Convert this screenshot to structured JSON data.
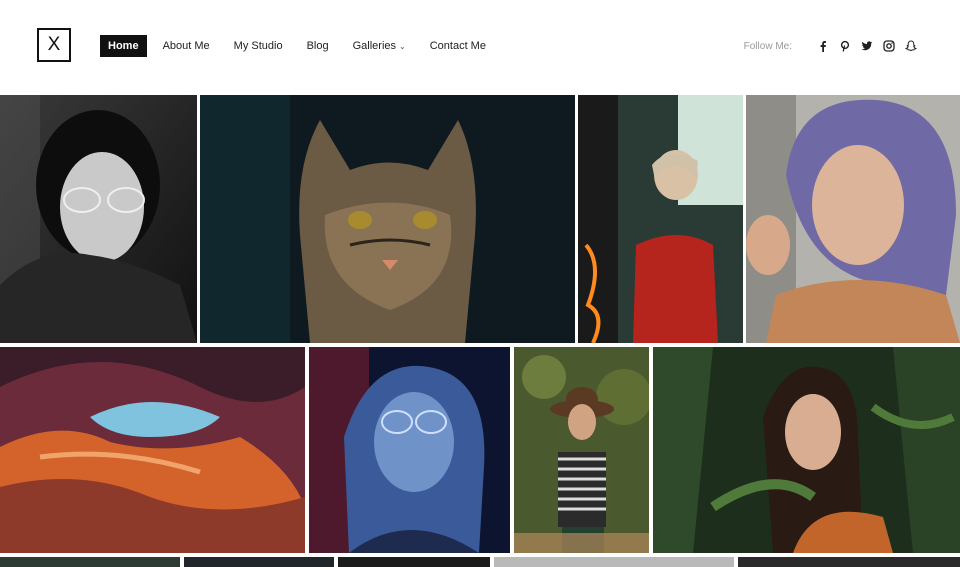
{
  "logo": {
    "text": "X"
  },
  "nav": {
    "items": [
      {
        "label": "Home",
        "active": true
      },
      {
        "label": "About Me"
      },
      {
        "label": "My Studio"
      },
      {
        "label": "Blog"
      },
      {
        "label": "Galleries",
        "dropdown": true
      },
      {
        "label": "Contact Me"
      }
    ]
  },
  "follow": {
    "label": "Follow Me:",
    "icons": [
      "facebook-icon",
      "pinterest-icon",
      "twitter-icon",
      "instagram-icon",
      "snapchat-icon"
    ]
  },
  "gallery": {
    "photos": [
      "bw-portrait-woman-glasses",
      "tabby-cat",
      "woman-red-top-neon",
      "woman-purple-hair",
      "canyon-rock-arch",
      "woman-blue-light-glasses",
      "woman-hat-striped-shirt",
      "woman-forest-leaves"
    ]
  }
}
